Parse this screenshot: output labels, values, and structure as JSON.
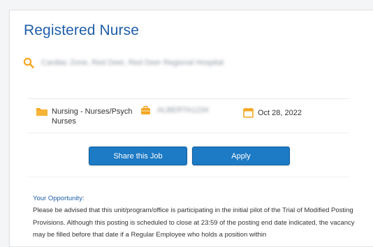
{
  "job": {
    "title": "Registered Nurse",
    "location": "Cardiac Zone, Red Deer, Red Deer Regional Hospital"
  },
  "meta": {
    "category": "Nursing - Nurses/Psych Nurses",
    "job_id": "ALBERTA1234",
    "date": "Oct 28, 2022"
  },
  "actions": {
    "share_label": "Share this Job",
    "apply_label": "Apply"
  },
  "opportunity": {
    "heading": "Your Opportunity:",
    "body": "Please be advised that this unit/program/office is participating in the initial pilot of the Trial of Modified Posting Provisions. Although this posting is scheduled to close at 23:59 of the posting end date indicated, the vacancy may be filled before that date if a Regular Employee who holds a position within"
  },
  "colors": {
    "accent": "#1f5ea8",
    "button": "#1d7ac4",
    "icon": "#f5a623"
  }
}
